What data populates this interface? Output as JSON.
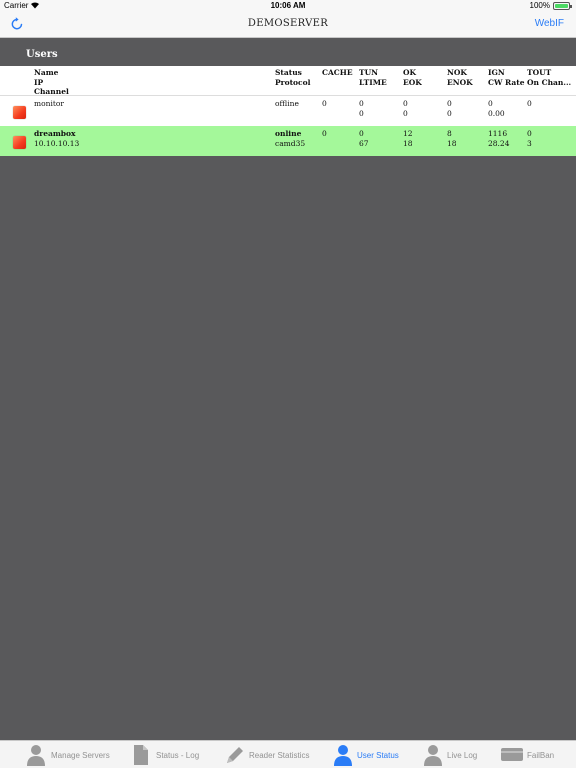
{
  "status_bar": {
    "carrier": "Carrier",
    "time": "10:06 AM",
    "battery": "100%"
  },
  "nav": {
    "title": "DEMOSERVER",
    "right_button": "WebIF",
    "left_icon": "refresh-icon"
  },
  "section": {
    "title": "Users"
  },
  "table": {
    "headers": {
      "name": [
        "Name",
        "IP",
        "Channel"
      ],
      "status": [
        "Status",
        "Protocol"
      ],
      "cache": [
        "CACHE"
      ],
      "tun": [
        "TUN",
        "LTIME"
      ],
      "ok": [
        "OK",
        "EOK"
      ],
      "nok": [
        "NOK",
        "ENOK"
      ],
      "ign": [
        "IGN",
        "CW Rate"
      ],
      "tout": [
        "TOUT",
        "On Chan..."
      ]
    },
    "rows": [
      {
        "name": "monitor",
        "ip": "",
        "status": "offline",
        "protocol": "",
        "cache": "0",
        "tun": "0",
        "ltime": "0",
        "ok": "0",
        "eok": "0",
        "nok": "0",
        "enok": "0",
        "ign": "0",
        "cw_rate": "0.00",
        "tout": "0",
        "on_chan": ""
      },
      {
        "name": "dreambox",
        "ip": "10.10.10.13",
        "status": "online",
        "protocol": "camd35",
        "cache": "0",
        "tun": "0",
        "ltime": "67",
        "ok": "12",
        "eok": "18",
        "nok": "8",
        "enok": "18",
        "ign": "1116",
        "cw_rate": "28.24",
        "tout": "0",
        "on_chan": "3"
      }
    ]
  },
  "tabs": [
    {
      "label": "Manage Servers",
      "icon": "person-icon",
      "active": false
    },
    {
      "label": "Status - Log",
      "icon": "document-icon",
      "active": false
    },
    {
      "label": "Reader Statistics",
      "icon": "pencil-icon",
      "active": false
    },
    {
      "label": "User Status",
      "icon": "user-icon",
      "active": true
    },
    {
      "label": "Live Log",
      "icon": "person-icon",
      "active": false
    },
    {
      "label": "FailBan",
      "icon": "card-icon",
      "active": false
    }
  ],
  "colors": {
    "accent": "#2a7cf6",
    "background": "#59595b",
    "online_row": "#a4f89a"
  }
}
